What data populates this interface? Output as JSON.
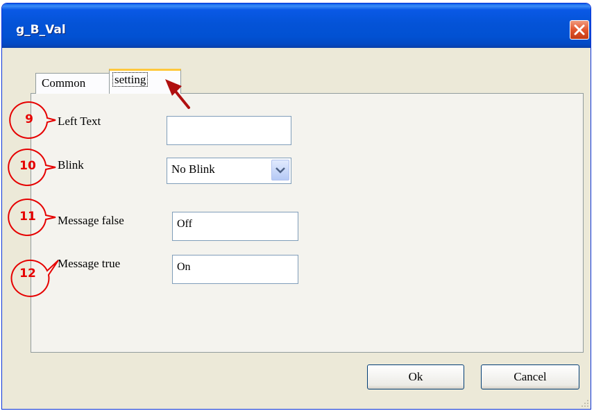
{
  "window": {
    "title": "g_B_Val"
  },
  "tabs": [
    {
      "label": "Common",
      "active": false
    },
    {
      "label": "setting",
      "active": true
    }
  ],
  "fields": {
    "left_text": {
      "label": "Left Text",
      "value": ""
    },
    "blink": {
      "label": "Blink",
      "selected": "No Blink"
    },
    "message_false": {
      "label": "Message false",
      "value": "Off"
    },
    "message_true": {
      "label": "Message true",
      "value": "On"
    }
  },
  "buttons": {
    "ok": "Ok",
    "cancel": "Cancel"
  },
  "annotations": [
    {
      "number": "9",
      "target": "Left Text"
    },
    {
      "number": "10",
      "target": "Blink"
    },
    {
      "number": "11",
      "target": "Message false"
    },
    {
      "number": "12",
      "target": "Message true"
    }
  ],
  "colors": {
    "annotation_red": "#e60000",
    "arrow_red": "#b01010",
    "titlebar_blue": "#0453d7",
    "dialog_bg": "#ece9d8",
    "active_tab_accent": "#ffc83c"
  },
  "icons": [
    "close-icon",
    "chevron-down-icon",
    "pointer-arrow-icon"
  ]
}
